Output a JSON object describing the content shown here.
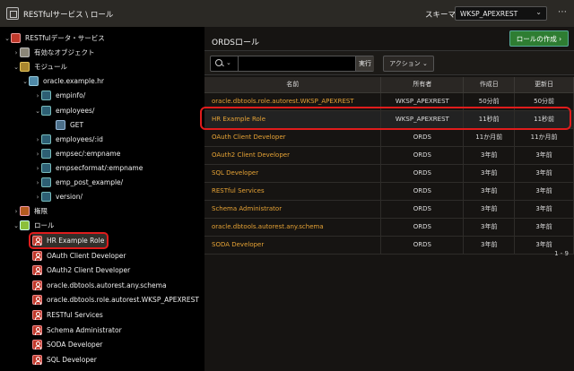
{
  "topbar": {
    "breadcrumb": "RESTfulサービス \\ ロール",
    "schema_label": "スキーマ",
    "schema_value": "WKSP_APEXREST",
    "more_icon": "⋯"
  },
  "tree": [
    {
      "label": "RESTfulデータ・サービス",
      "icon": "rest-service-icon",
      "toggle": "⌄"
    },
    {
      "label": "有効なオブジェクト",
      "icon": "enabled-objects-icon",
      "toggle": "›"
    },
    {
      "label": "モジュール",
      "icon": "modules-icon",
      "toggle": "⌄"
    },
    {
      "label": "oracle.example.hr",
      "icon": "module-icon",
      "toggle": "⌄"
    },
    {
      "label": "empinfo/",
      "icon": "template-icon",
      "toggle": "›"
    },
    {
      "label": "employees/",
      "icon": "template-icon",
      "toggle": "⌄"
    },
    {
      "label": "GET",
      "icon": "get-handler-icon",
      "toggle": ""
    },
    {
      "label": "employees/:id",
      "icon": "template-icon",
      "toggle": "›"
    },
    {
      "label": "empsec/:empname",
      "icon": "template-icon",
      "toggle": "›"
    },
    {
      "label": "empsecformat/:empname",
      "icon": "template-icon",
      "toggle": "›"
    },
    {
      "label": "emp_post_example/",
      "icon": "template-icon",
      "toggle": "›"
    },
    {
      "label": "version/",
      "icon": "template-icon",
      "toggle": "›"
    },
    {
      "label": "権限",
      "icon": "privileges-icon",
      "toggle": "›"
    },
    {
      "label": "ロール",
      "icon": "roles-icon",
      "toggle": "⌄"
    },
    {
      "label": "HR Example Role",
      "icon": "role-icon",
      "toggle": ""
    },
    {
      "label": "OAuth Client Developer",
      "icon": "role-icon",
      "toggle": ""
    },
    {
      "label": "OAuth2 Client Developer",
      "icon": "role-icon",
      "toggle": ""
    },
    {
      "label": "oracle.dbtools.autorest.any.schema",
      "icon": "role-icon",
      "toggle": ""
    },
    {
      "label": "oracle.dbtools.role.autorest.WKSP_APEXREST",
      "icon": "role-icon",
      "toggle": ""
    },
    {
      "label": "RESTful Services",
      "icon": "role-icon",
      "toggle": ""
    },
    {
      "label": "Schema Administrator",
      "icon": "role-icon",
      "toggle": ""
    },
    {
      "label": "SODA Developer",
      "icon": "role-icon",
      "toggle": ""
    },
    {
      "label": "SQL Developer",
      "icon": "role-icon",
      "toggle": ""
    }
  ],
  "main": {
    "title": "ORDSロール",
    "create_button": "ロールの作成 ›",
    "search_placeholder": "",
    "go_button": "実行",
    "actions_button": "アクション ⌄",
    "columns": [
      "名前",
      "所有者",
      "作成日",
      "更新日"
    ],
    "rows": [
      [
        "oracle.dbtools.role.autorest.WKSP_APEXREST",
        "WKSP_APEXREST",
        "50分前",
        "50分前"
      ],
      [
        "HR Example Role",
        "WKSP_APEXREST",
        "11秒前",
        "11秒前"
      ],
      [
        "OAuth Client Developer",
        "ORDS",
        "11か月前",
        "11か月前"
      ],
      [
        "OAuth2 Client Developer",
        "ORDS",
        "3年前",
        "3年前"
      ],
      [
        "SQL Developer",
        "ORDS",
        "3年前",
        "3年前"
      ],
      [
        "RESTful Services",
        "ORDS",
        "3年前",
        "3年前"
      ],
      [
        "Schema Administrator",
        "ORDS",
        "3年前",
        "3年前"
      ],
      [
        "oracle.dbtools.autorest.any.schema",
        "ORDS",
        "3年前",
        "3年前"
      ],
      [
        "SODA Developer",
        "ORDS",
        "3年前",
        "3年前"
      ]
    ],
    "pagination": "1 - 9"
  },
  "colors": {
    "accent_link": "#e5a235",
    "highlight": "#e01c1c",
    "create_button": "#2e7d32"
  }
}
